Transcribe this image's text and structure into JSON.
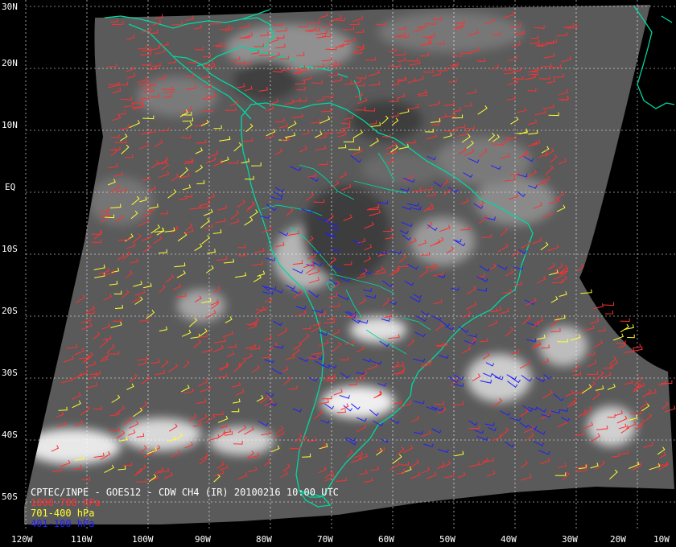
{
  "title": "CPTEC/INPE - GOES12 - CDW CH4 (IR) 20100216 10:00 UTC",
  "legend": [
    {
      "label": "1000-700 hPa",
      "color": "#ff3030"
    },
    {
      "label": "701-400 hPa",
      "color": "#ffff30"
    },
    {
      "label": "401-100 hPa",
      "color": "#2020ff"
    }
  ],
  "latitude_labels": [
    "30N",
    "20N",
    "10N",
    "EQ",
    "10S",
    "20S",
    "30S",
    "40S",
    "50S"
  ],
  "longitude_labels": [
    "120W",
    "110W",
    "100W",
    "90W",
    "80W",
    "70W",
    "60W",
    "50W",
    "40W",
    "30W",
    "20W",
    "10W"
  ],
  "colors": {
    "background": "#000000",
    "coastline": "#00d8a0",
    "grid": "#ffffff",
    "satellite_gray": "#5a5a5a"
  }
}
